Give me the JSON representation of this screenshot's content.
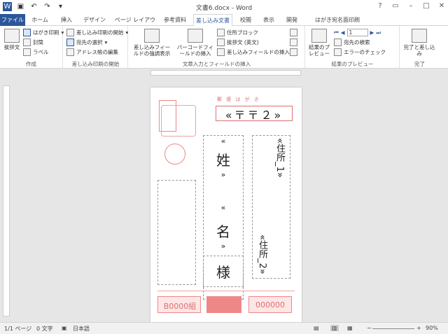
{
  "window": {
    "title": "文書6.docx - Word"
  },
  "tabs": [
    {
      "label": "ファイル"
    },
    {
      "label": "ホーム"
    },
    {
      "label": "挿入"
    },
    {
      "label": "デザイン"
    },
    {
      "label": "ページ レイアウト"
    },
    {
      "label": "参考資料"
    },
    {
      "label": "差し込み文書"
    },
    {
      "label": "校閲"
    },
    {
      "label": "表示"
    },
    {
      "label": "開発"
    },
    {
      "label": "はがき宛名面印刷"
    }
  ],
  "ribbon": {
    "create": {
      "label": "作成",
      "greeting": "挨拶文",
      "hagaki": "はがき印刷",
      "envelope": "封筒",
      "labels": "ラベル"
    },
    "start": {
      "label": "差し込み印刷の開始",
      "start_merge": "差し込み印刷の開始",
      "select_recipients": "宛先の選択",
      "edit_list": "アドレス帳の編集"
    },
    "write": {
      "label": "文章入力とフィールドの挿入",
      "highlight": "差し込みフィールドの強調表示",
      "barcode": "バーコードフィールドの挿入",
      "address_block": "住所ブロック",
      "greeting_en": "挨拶文 (英文)",
      "insert_field": "差し込みフィールドの挿入"
    },
    "preview": {
      "label": "結果のプレビュー",
      "preview_results": "結果のプレビュー",
      "record": "1",
      "find_recipient": "宛先の検索",
      "check_errors": "エラーのチェック"
    },
    "finish": {
      "label": "完了",
      "finish_merge": "完了と差し込み"
    }
  },
  "postcard": {
    "header": "郵 便 は が き",
    "postal_code": "«〒〒２»",
    "name1_top": "«",
    "name1": "姓",
    "name1_bottom": "»",
    "name2_top": "«",
    "name2": "名",
    "name2_bottom": "»",
    "honorific": "様",
    "address1": "«住所_1»",
    "address2": "«住所_2»",
    "footer_left": "B0000組",
    "footer_right": "000000"
  },
  "status": {
    "page": "1/1 ページ",
    "words": "0 文字",
    "lang": "日本語",
    "zoom": "90%"
  },
  "colors": {
    "file_tab": "#2b579a",
    "stamp": "#e07070"
  }
}
